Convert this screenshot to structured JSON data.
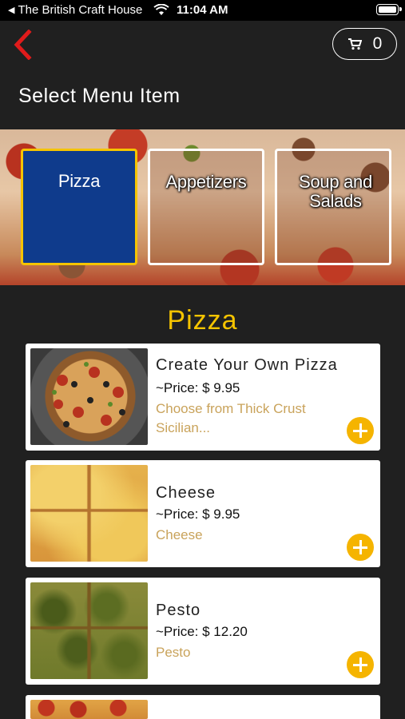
{
  "status_bar": {
    "back_app": "The British Craft House",
    "time": "11:04 AM"
  },
  "header": {
    "cart_count": "0",
    "title": "Select Menu Item"
  },
  "categories": [
    {
      "label": "Pizza",
      "active": true
    },
    {
      "label": "Appetizers",
      "active": false
    },
    {
      "label": "Soup and Salads",
      "active": false
    }
  ],
  "section": {
    "title": "Pizza"
  },
  "items": [
    {
      "name": "Create Your Own Pizza",
      "price": "~Price: $ 9.95",
      "description": "Choose from Thick Crust Sicilian..."
    },
    {
      "name": "Cheese",
      "price": "~Price: $ 9.95",
      "description": "Cheese"
    },
    {
      "name": "Pesto",
      "price": "~Price: $ 12.20",
      "description": "Pesto"
    }
  ],
  "colors": {
    "accent": "#f5c400",
    "add_button": "#f5b400",
    "back_arrow": "#e01b1b",
    "active_category": "#0f3b8c",
    "description_text": "#c9a35b"
  }
}
